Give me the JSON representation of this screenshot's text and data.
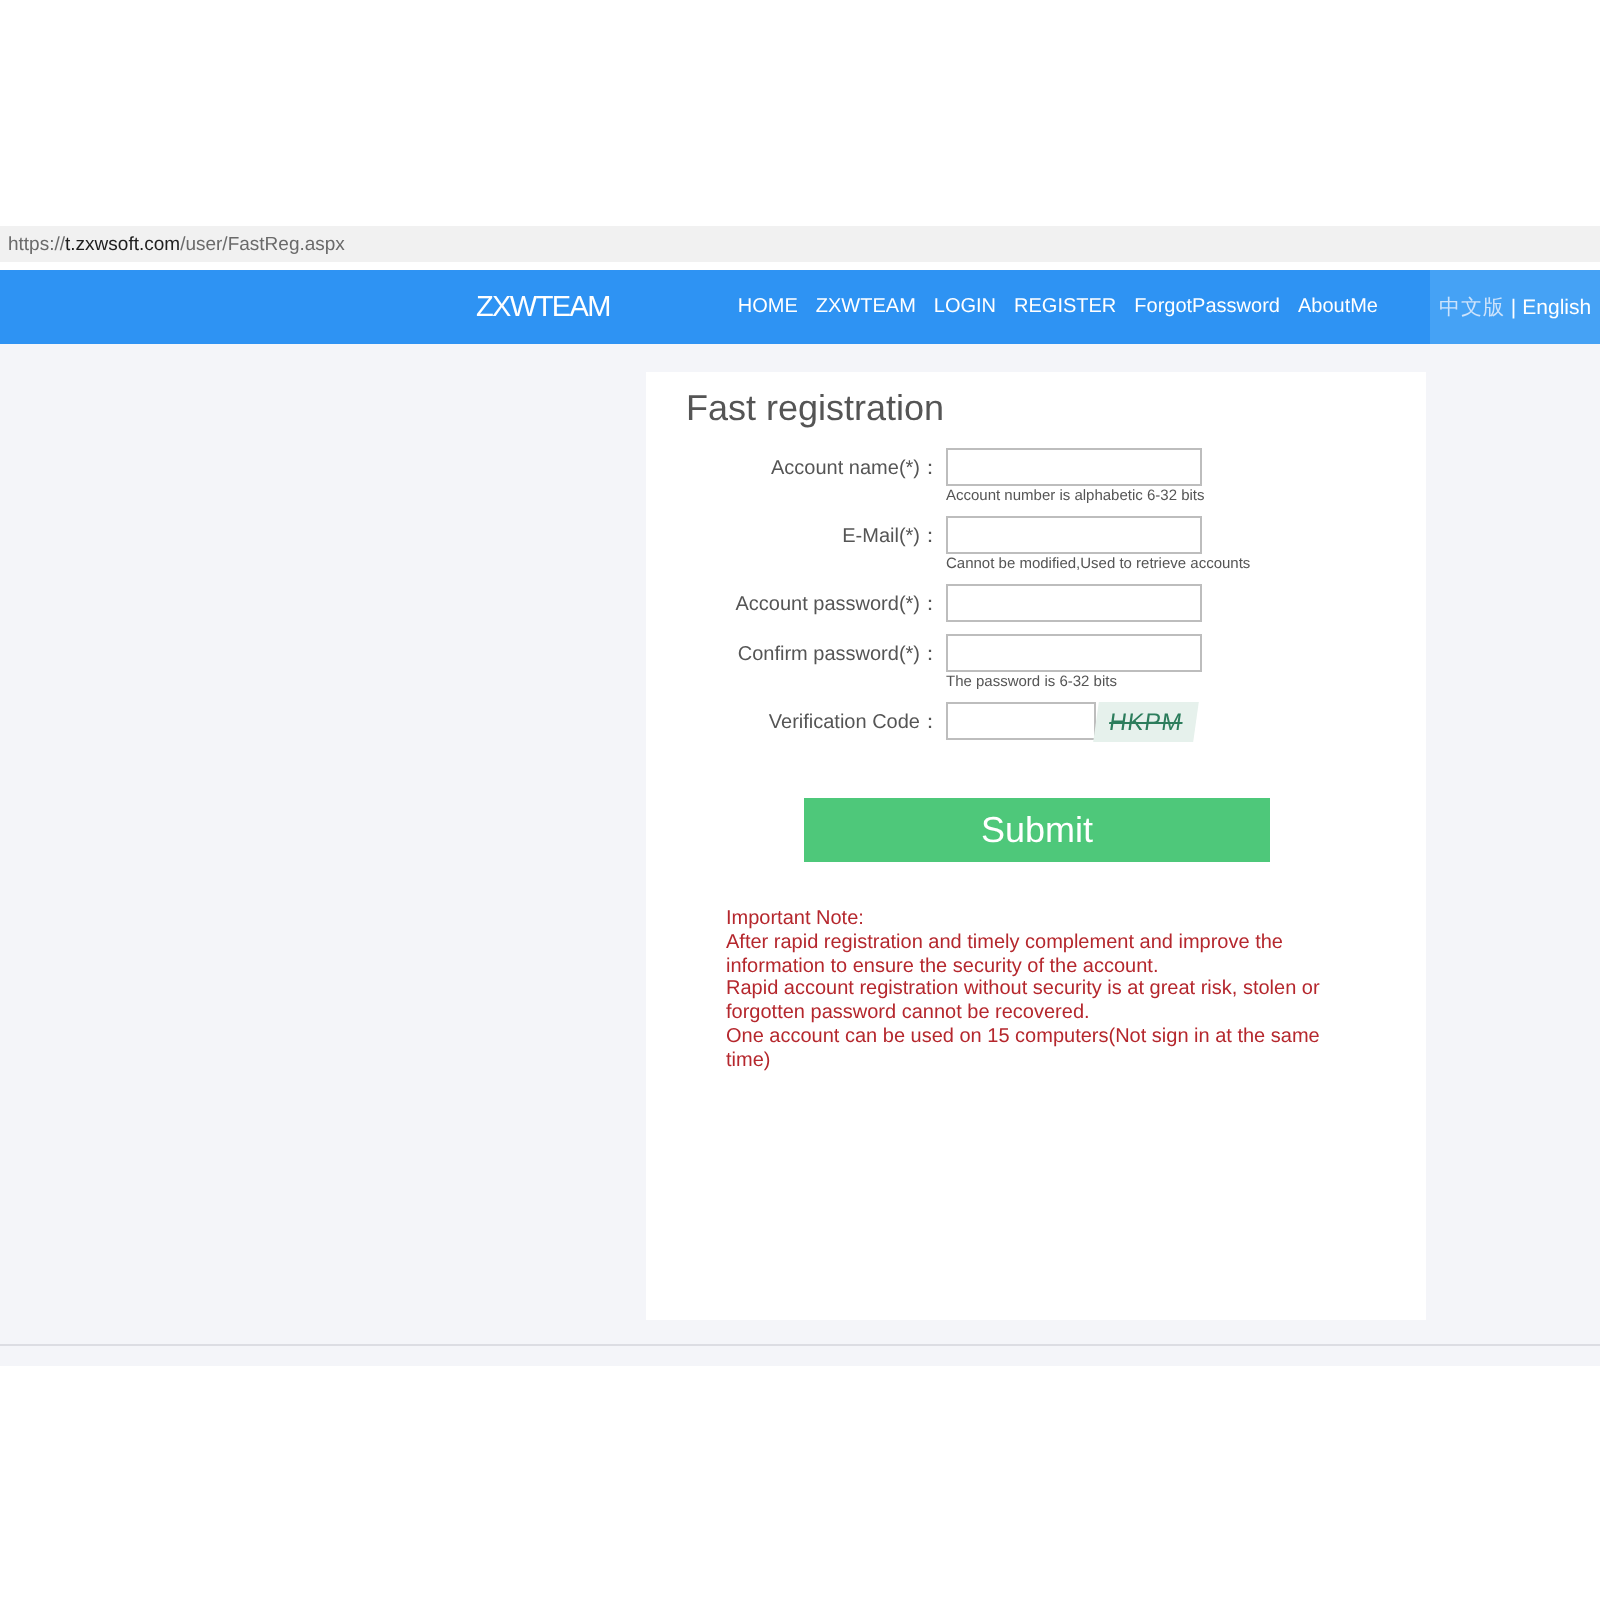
{
  "address_bar": {
    "scheme": "https://",
    "host": "t.zxwsoft.com",
    "path": "/user/FastReg.aspx"
  },
  "header": {
    "logo": "ZXWTEAM",
    "nav": [
      "HOME",
      "ZXWTEAM",
      "LOGIN",
      "REGISTER",
      "ForgotPassword",
      "AboutMe"
    ],
    "languages": [
      {
        "label": "中文版",
        "selected": false
      },
      {
        "label": "English",
        "selected": true
      }
    ],
    "language_separator": "|"
  },
  "form": {
    "title": "Fast registration",
    "fields": [
      {
        "kind": "input",
        "label": "Account name(*)：",
        "hint": "Account number is alphabetic 6-32 bits"
      },
      {
        "kind": "input",
        "label": "E-Mail(*)：",
        "hint": "Cannot be modified,Used to retrieve accounts"
      },
      {
        "kind": "input",
        "label": "Account password(*)："
      },
      {
        "kind": "input",
        "label": "Confirm password(*)：",
        "hint": "The password is 6-32 bits"
      },
      {
        "kind": "captcha",
        "label": "Verification Code：",
        "captcha": "HKPM"
      }
    ],
    "submit": "Submit",
    "note": {
      "title": "Important Note:",
      "lines": [
        "After rapid registration and timely complement and improve the information to ensure the security of the account.",
        "Rapid account registration without security is at great risk, stolen or forgotten password cannot be recovered.",
        "One account can be used on 15 computers(Not sign in at the same time)"
      ]
    }
  }
}
